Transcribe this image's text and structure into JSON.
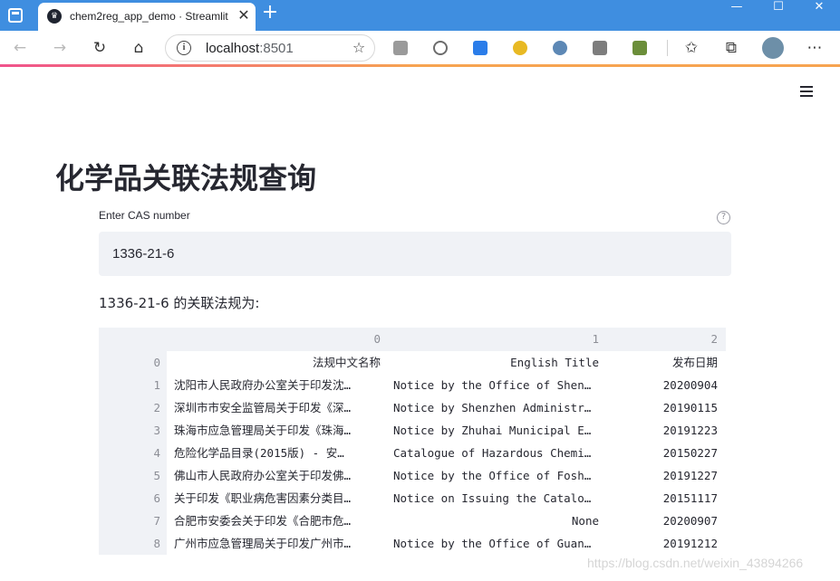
{
  "browser": {
    "tab_title": "chem2reg_app_demo · Streamlit",
    "address_host": "localhost",
    "address_port": ":8501",
    "window_controls": {
      "minimize": "—",
      "maximize": "☐",
      "close": "✕"
    }
  },
  "page": {
    "title": "化学品关联法规查询",
    "cas_label": "Enter CAS number",
    "cas_value": "1336-21-6",
    "result_text": "1336-21-6 的关联法规为:"
  },
  "table": {
    "columns": [
      "0",
      "1",
      "2"
    ],
    "rows": [
      {
        "index": "0",
        "c0": "法规中文名称",
        "c1": "English Title",
        "c2": "发布日期"
      },
      {
        "index": "1",
        "c0": "沈阳市人民政府办公室关于印发沈…",
        "c1": "Notice by the Office of Shen…",
        "c2": "20200904"
      },
      {
        "index": "2",
        "c0": "深圳市市安全监管局关于印发《深…",
        "c1": "Notice by Shenzhen Administr…",
        "c2": "20190115"
      },
      {
        "index": "3",
        "c0": "珠海市应急管理局关于印发《珠海…",
        "c1": "Notice by Zhuhai Municipal E…",
        "c2": "20191223"
      },
      {
        "index": "4",
        "c0": "危险化学品目录(2015版) - 安…",
        "c1": "Catalogue of Hazardous Chemi…",
        "c2": "20150227"
      },
      {
        "index": "5",
        "c0": "佛山市人民政府办公室关于印发佛…",
        "c1": "Notice by the Office of Fosh…",
        "c2": "20191227"
      },
      {
        "index": "6",
        "c0": "关于印发《职业病危害因素分类目…",
        "c1": "Notice on Issuing the Catalo…",
        "c2": "20151117"
      },
      {
        "index": "7",
        "c0": "合肥市安委会关于印发《合肥市危…",
        "c1": "None",
        "c2": "20200907"
      },
      {
        "index": "8",
        "c0": "广州市应急管理局关于印发广州市…",
        "c1": "Notice by the Office of Guan…",
        "c2": "20191212"
      }
    ]
  },
  "watermark": "https://blog.csdn.net/weixin_43894266"
}
